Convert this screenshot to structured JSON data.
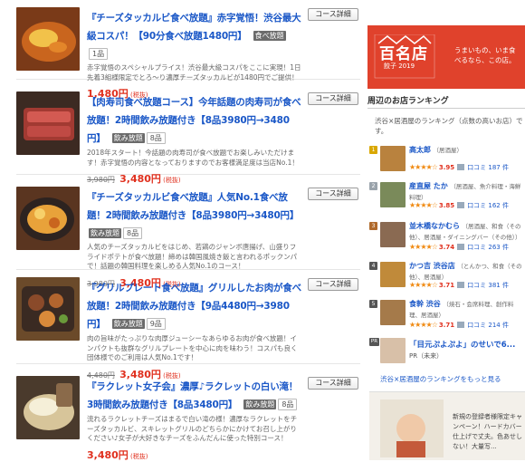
{
  "courses": [
    {
      "title": "『チーズタッカルビ食べ放題』赤字覚悟！渋谷最大級コスパ！【90分食べ放題1480円】",
      "tag": "食べ放題",
      "count": "1品",
      "desc": "赤字覚悟のスペシャルプライス！渋谷最大級コスパをここに実現！1日先着3組様限定でとろ～り濃厚チーズタッカルビが1480円でご提供！",
      "old_price": "",
      "price": "1,480円",
      "tax": "(税抜)",
      "button": "コース詳細"
    },
    {
      "title": "【肉寿司食べ放題コース】今年話題の肉寿司が食べ放題！2時間飲み放題付き【8品3980円→3480円】",
      "tag": "飲み放題",
      "count": "8品",
      "desc": "2018年スタート！今話題の肉寿司が食べ放題でお楽しみいただけます！赤字覚悟の内容となっておりますのでお客様満足度は当店No.1！",
      "old_price": "3,980円",
      "price": "3,480円",
      "tax": "(税抜)",
      "button": "コース詳細"
    },
    {
      "title": "『チーズタッカルビ食べ放題』人気No.1食べ放題！2時間飲み放題付き【8品3980円→3480円】",
      "tag": "飲み放題",
      "count": "8品",
      "desc": "人気のチーズタッカルビをはじめ、若鶏のジャンボ唐揚げ、山盛りフライドポテトが食べ放題！締めは韓国風焼き飯と言われるポックンパで！話題の韓国料理を楽しめる人気No.1のコース！",
      "old_price": "3,980円",
      "price": "3,480円",
      "tax": "(税抜)",
      "button": "コース詳細"
    },
    {
      "title": "『グリルプレート食べ放題』グリルしたお肉が食べ放題！2時間飲み放題付き【9品4480円→3980円】",
      "tag": "飲み放題",
      "count": "9品",
      "desc": "肉の旨味がたっぷりな肉厚ジューシーなあらゆるお肉が食べ放題！インパクトも抜群なグリルプレートを中心に肉を味わう！コスパも良く団体様でのご利用は人気No.1です！",
      "old_price": "4,480円",
      "price": "3,480円",
      "tax": "(税抜)",
      "button": "コース詳細"
    },
    {
      "title": "『ラクレット女子会』濃厚♪ラクレットの白い滝！3時間飲み放題付き【8品3480円】",
      "tag": "飲み放題",
      "count": "8品",
      "desc": "流れるラクレットチーズはまるで白い滝の様！濃厚なラクレットをチーズタッカルビ、スキレットグリルのどちらかにかけてお召し上がりください♪女子が大好きなチーズをふんだんに使った特別コース！",
      "old_price": "",
      "price": "3,480円",
      "tax": "(税抜)",
      "button": "コース詳細"
    }
  ],
  "sidebar": {
    "banner": {
      "logo_big": "百名店",
      "logo_year": "餃子 2019",
      "copy": "うまいもの、いま食べるなら、この店。"
    },
    "ranking_title": "周辺のお店ランキング",
    "ranking_subtitle": "渋谷×居酒屋のランキング（点数の高いお店）です。",
    "ranking": [
      {
        "rank": "1",
        "name": "高太郎",
        "genre": "（居酒屋）",
        "stars": "★★★★☆",
        "score": "3.95",
        "kuchi": "口コミ 187 件",
        "medal_color": "#d9a700"
      },
      {
        "rank": "2",
        "name": "産直屋 たか",
        "genre": "（居酒屋、魚介料理・海鮮料理）",
        "stars": "★★★★☆",
        "score": "3.85",
        "kuchi": "口コミ 162 件",
        "medal_color": "#9aa3ab"
      },
      {
        "rank": "3",
        "name": "並木橋なかむら",
        "genre": "（居酒屋、和食（その他）、居酒屋・ダイニングバー（その他））",
        "stars": "★★★★☆",
        "score": "3.74",
        "kuchi": "口コミ 263 件",
        "medal_color": "#b06a2c"
      },
      {
        "rank": "4",
        "name": "かつ吉 渋谷店",
        "genre": "（とんかつ、和食（その他）、居酒屋）",
        "stars": "★★★★☆",
        "score": "3.71",
        "kuchi": "口コミ 381 件",
        "medal_color": "#555555"
      },
      {
        "rank": "5",
        "name": "食幹 渋谷",
        "genre": "（焼石・会席料理、創作料理、居酒屋）",
        "stars": "★★★★☆",
        "score": "3.71",
        "kuchi": "口コミ 214 件",
        "medal_color": "#555555"
      }
    ],
    "pr": {
      "badge": "PR",
      "title": "「目元ぷよぷよ」のせいで6...",
      "sub": "PR（未来）"
    },
    "more_link": "渋谷×居酒屋のランキングをもっと見る",
    "ad_text": "新規の登録者様限定キャンペーン！ハードカバー仕上げで丈夫。色あせしない！大量写..."
  }
}
